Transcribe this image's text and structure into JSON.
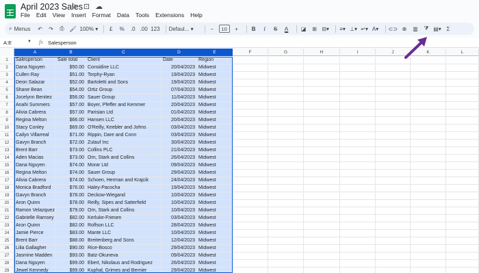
{
  "app": {
    "title": "April 2023 Sales",
    "menu": [
      "File",
      "Edit",
      "View",
      "Insert",
      "Format",
      "Data",
      "Tools",
      "Extensions",
      "Help"
    ]
  },
  "toolbar": {
    "menus_label": "Menus",
    "zoom": "100%",
    "currency": "£",
    "percent": "%",
    "dec_decrease": ".0",
    "dec_increase": ".00",
    "number_format": "123",
    "font": "Defaul...",
    "font_size": "10",
    "minus": "−",
    "plus": "+",
    "bold": "B",
    "italic": "I",
    "strikethrough": "S",
    "text_color": "A",
    "functions": "Σ",
    "accent": "#6a2c91"
  },
  "formula_bar": {
    "name_box": "A:E",
    "fx": "fx",
    "value": "Salesperson"
  },
  "grid": {
    "columns": [
      "A",
      "B",
      "C",
      "D",
      "E",
      "F",
      "G",
      "H",
      "I",
      "J",
      "K",
      "L"
    ],
    "row_numbers": [
      "1",
      "2",
      "3",
      "4",
      "5",
      "6",
      "7",
      "8",
      "9",
      "10",
      "11",
      "12",
      "13",
      "14",
      "15",
      "16",
      "17",
      "18",
      "19",
      "20",
      "21",
      "22",
      "23",
      "24",
      "25",
      "26",
      "27",
      "28",
      "29"
    ],
    "rows": [
      [
        "Salesperson",
        "Sale total",
        "Client",
        "Date",
        "Region"
      ],
      [
        "Dana Nguyen",
        "$50.00",
        "Considine LLC",
        "20/04/2023",
        "Midwest"
      ],
      [
        "Cullen Ray",
        "$51.00",
        "Torphy-Ryan",
        "19/04/2023",
        "Midwest"
      ],
      [
        "Deon Salazar",
        "$52.00",
        "Bartoletti and Sons",
        "19/04/2023",
        "Midwest"
      ],
      [
        "Shane Bean",
        "$54.00",
        "Ortiz Group",
        "07/04/2023",
        "Midwest"
      ],
      [
        "Jocelynn Benitez",
        "$56.00",
        "Sauer Group",
        "11/04/2023",
        "Midwest"
      ],
      [
        "Anahi Summers",
        "$57.00",
        "Boyer, Pfeffer and Kemmer",
        "20/04/2023",
        "Midwest"
      ],
      [
        "Alivia Cabrera",
        "$57.00",
        "Parisian Ltd",
        "01/04/2023",
        "Midwest"
      ],
      [
        "Regina Melton",
        "$66.00",
        "Hansen LLC",
        "20/04/2023",
        "Midwest"
      ],
      [
        "Stacy Conley",
        "$69.00",
        "O'Reilly, Keebler and Johns",
        "03/04/2023",
        "Midwest"
      ],
      [
        "Cailyn Villarreal",
        "$71.00",
        "Rippin, Dare and Conn",
        "03/04/2023",
        "Midwest"
      ],
      [
        "Gavyn Branch",
        "$72.00",
        "Zulauf Inc",
        "30/04/2023",
        "Midwest"
      ],
      [
        "Brent Barr",
        "$73.00",
        "Collins PLC",
        "21/04/2023",
        "Midwest"
      ],
      [
        "Aden Macias",
        "$73.00",
        "Orn, Stark and Collins",
        "26/04/2023",
        "Midwest"
      ],
      [
        "Dana Nguyen",
        "$74.00",
        "Morar Ltd",
        "09/04/2023",
        "Midwest"
      ],
      [
        "Regina Melton",
        "$74.00",
        "Sauer Group",
        "29/04/2023",
        "Midwest"
      ],
      [
        "Alivia Cabrera",
        "$74.00",
        "Schoen, Herman and Krajcik",
        "24/04/2023",
        "Midwest"
      ],
      [
        "Monica Bradford",
        "$76.00",
        "Haley-Pacocha",
        "19/04/2023",
        "Midwest"
      ],
      [
        "Gavyn Branch",
        "$78.00",
        "Deckow-Wiegand",
        "10/04/2023",
        "Midwest"
      ],
      [
        "Aron Quinn",
        "$78.00",
        "Reilly, Sipes and Satterfield",
        "10/04/2023",
        "Midwest"
      ],
      [
        "Ramon Velazquez",
        "$79.00",
        "Orn, Stark and Collins",
        "10/04/2023",
        "Midwest"
      ],
      [
        "Gabrielle Ramsey",
        "$82.00",
        "Kerluke-Friesen",
        "03/04/2023",
        "Midwest"
      ],
      [
        "Aron Quinn",
        "$82.00",
        "Rolfson LLC",
        "28/04/2023",
        "Midwest"
      ],
      [
        "Jamie Pierce",
        "$83.00",
        "Mante LLC",
        "10/04/2023",
        "Midwest"
      ],
      [
        "Brent Barr",
        "$88.00",
        "Breitenberg and Sons",
        "12/04/2023",
        "Midwest"
      ],
      [
        "Lilia Gallagher",
        "$90.00",
        "Rice-Bosco",
        "29/04/2023",
        "Midwest"
      ],
      [
        "Jasmine Madden",
        "$93.00",
        "Batz-Okuneva",
        "09/04/2023",
        "Midwest"
      ],
      [
        "Dana Nguyen",
        "$99.00",
        "Ebert, Nikolaus and Rodriguez",
        "26/04/2023",
        "Midwest"
      ],
      [
        "Jewel Kennedy",
        "$99.00",
        "Kuphal, Grimes and Bernier",
        "29/04/2023",
        "Midwest"
      ]
    ]
  }
}
